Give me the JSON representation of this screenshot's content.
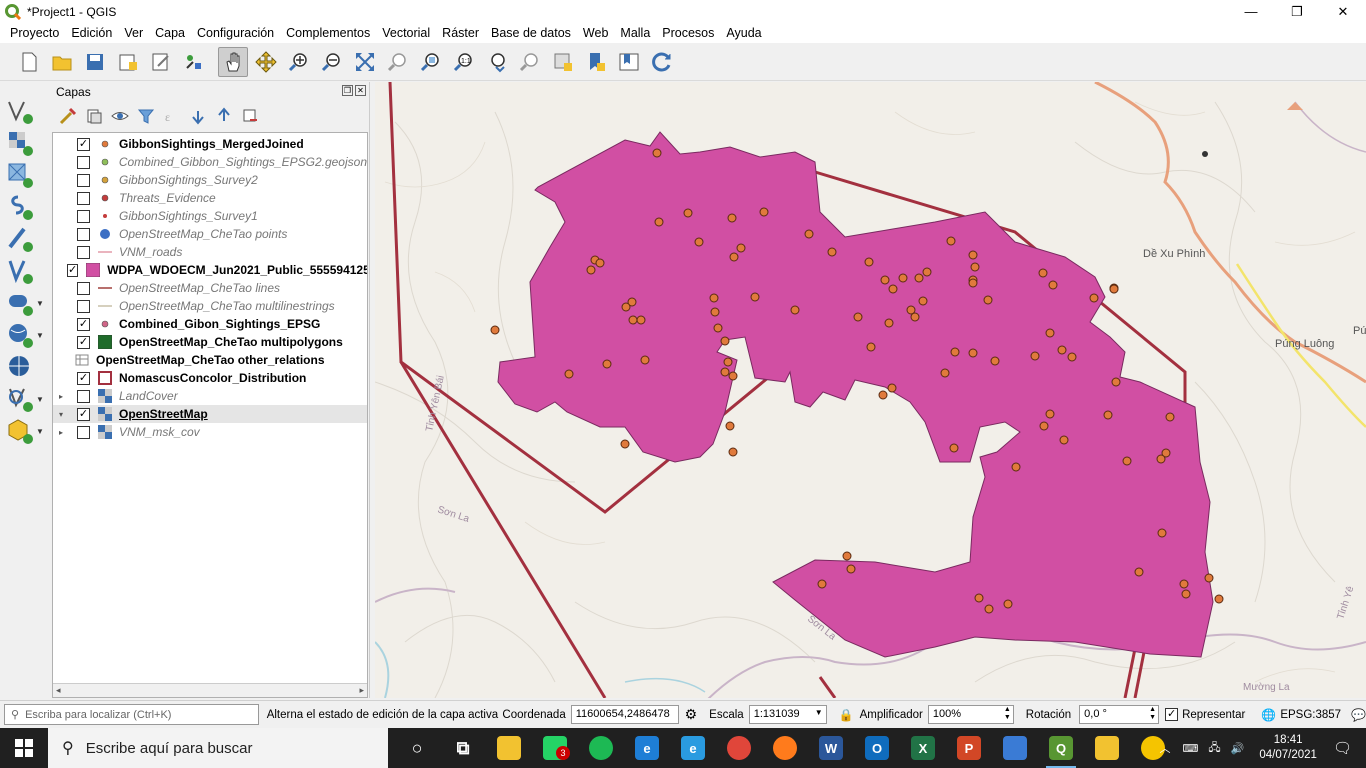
{
  "window": {
    "title": "*Project1 - QGIS",
    "controls": [
      "—",
      "❐",
      "✕"
    ]
  },
  "menu": [
    "Proyecto",
    "Edición",
    "Ver",
    "Capa",
    "Configuración",
    "Complementos",
    "Vectorial",
    "Ráster",
    "Base de datos",
    "Web",
    "Malla",
    "Procesos",
    "Ayuda"
  ],
  "toolbar_icons": [
    "new-project-icon",
    "open-project-icon",
    "save-project-icon",
    "new-print-layout-icon",
    "style-manager-icon",
    "pan-map-icon",
    "pan-to-selection-icon",
    "zoom-in-icon",
    "zoom-out-icon",
    "zoom-full-icon",
    "zoom-to-selection-icon",
    "zoom-to-layer-icon",
    "zoom-native-resolution-icon",
    "zoom-last-icon",
    "zoom-next-icon",
    "new-map-view-icon",
    "new-bookmark-icon",
    "show-bookmarks-icon",
    "refresh-icon"
  ],
  "layers_panel": {
    "title": "Capas",
    "layers": [
      {
        "name": "GibbonSightings_MergedJoined",
        "checked": true,
        "style": "bold",
        "symbol": "dot",
        "color": "#e07a3c",
        "expander": ""
      },
      {
        "name": "Combined_Gibbon_Sightings_EPSG2.geojson",
        "checked": false,
        "style": "italic",
        "symbol": "dot",
        "color": "#8fbf5a",
        "expander": ""
      },
      {
        "name": "GibbonSightings_Survey2",
        "checked": false,
        "style": "italic",
        "symbol": "dot",
        "color": "#d4a23c",
        "expander": ""
      },
      {
        "name": "Threats_Evidence",
        "checked": false,
        "style": "italic",
        "symbol": "dot",
        "color": "#c43c3c",
        "expander": ""
      },
      {
        "name": "GibbonSightings_Survey1",
        "checked": false,
        "style": "italic",
        "symbol": "smalldot",
        "color": "#c43c3c",
        "expander": ""
      },
      {
        "name": "OpenStreetMap_CheTao points",
        "checked": false,
        "style": "italic",
        "symbol": "bigdot",
        "color": "#3c6fc4",
        "expander": ""
      },
      {
        "name": "VNM_roads",
        "checked": false,
        "style": "italic",
        "symbol": "line",
        "color": "#e39aa8",
        "expander": ""
      },
      {
        "name": "WDPA_WDOECM_Jun2021_Public_555594125",
        "checked": true,
        "style": "bold",
        "symbol": "fill",
        "color": "#d14fa3",
        "expander": ""
      },
      {
        "name": "OpenStreetMap_CheTao lines",
        "checked": false,
        "style": "italic",
        "symbol": "line",
        "color": "#a0413c",
        "expander": ""
      },
      {
        "name": "OpenStreetMap_CheTao multilinestrings",
        "checked": false,
        "style": "italic",
        "symbol": "line",
        "color": "#c8c0a8",
        "expander": ""
      },
      {
        "name": "Combined_Gibon_Sightings_EPSG",
        "checked": true,
        "style": "bold",
        "symbol": "dot",
        "color": "#d06688",
        "expander": ""
      },
      {
        "name": "OpenStreetMap_CheTao multipolygons",
        "checked": true,
        "style": "bold",
        "symbol": "fill",
        "color": "#1f6b2a",
        "expander": ""
      },
      {
        "name": "OpenStreetMap_CheTao other_relations",
        "checked": null,
        "style": "bold",
        "symbol": "table",
        "color": "#888888",
        "expander": ""
      },
      {
        "name": "NomascusConcolor_Distribution",
        "checked": true,
        "style": "bold",
        "symbol": "outline",
        "color": "#a3303f",
        "expander": ""
      },
      {
        "name": "LandCover",
        "checked": false,
        "style": "italic",
        "symbol": "raster",
        "color": "#555555",
        "expander": "▸"
      },
      {
        "name": "OpenStreetMap",
        "checked": true,
        "style": "underline",
        "symbol": "raster",
        "color": "#555555",
        "expander": "▾"
      },
      {
        "name": "VNM_msk_cov",
        "checked": false,
        "style": "italic",
        "symbol": "raster",
        "color": "#555555",
        "expander": "▸"
      }
    ]
  },
  "map": {
    "colors": {
      "background": "#f2efe9",
      "protected_area_fill": "#d14fa3",
      "distribution_outline": "#a3303f",
      "sighting_points": "#e07a3c",
      "road": "#e8a07c"
    },
    "labels": [
      {
        "text": "Dề Xu Phình"
      },
      {
        "text": "Púng Luông"
      },
      {
        "text": "Tỉnh Yên Bái"
      },
      {
        "text": "Sơn La"
      },
      {
        "text": "Sơn La"
      },
      {
        "text": "Mường La"
      },
      {
        "text": "Tỉnh Yê"
      },
      {
        "text": "Pú"
      }
    ]
  },
  "status": {
    "locator_placeholder": "Escriba para localizar (Ctrl+K)",
    "message": "Alterna el estado de edición de la capa activa",
    "coordinate_label": "Coordenada",
    "coordinate_value": "11600654,2486478",
    "scale_label": "Escala",
    "scale_value": "1:131039",
    "magnifier_label": "Amplificador",
    "magnifier_value": "100%",
    "rotation_label": "Rotación",
    "rotation_value": "0,0 °",
    "render_label": "Representar",
    "render_checked": true,
    "crs": "EPSG:3857"
  },
  "taskbar": {
    "search_placeholder": "Escribe aquí para buscar",
    "apps": [
      {
        "name": "cortana-icon",
        "glyph": "○",
        "bg": "#202020"
      },
      {
        "name": "task-view-icon",
        "glyph": "⧉",
        "bg": "#202020"
      },
      {
        "name": "file-explorer-icon",
        "glyph": "",
        "bg": "#f2c230"
      },
      {
        "name": "whatsapp-icon",
        "glyph": "",
        "bg": "#25d366",
        "badge": "3"
      },
      {
        "name": "spotify-icon",
        "glyph": "",
        "bg": "#1db954"
      },
      {
        "name": "internet-explorer-icon",
        "glyph": "e",
        "bg": "#1e7ed6"
      },
      {
        "name": "edge-icon",
        "glyph": "e",
        "bg": "#2a9be0"
      },
      {
        "name": "chrome-icon",
        "glyph": "",
        "bg": "#e0463a"
      },
      {
        "name": "firefox-icon",
        "glyph": "",
        "bg": "#ff7b1c"
      },
      {
        "name": "word-icon",
        "glyph": "W",
        "bg": "#2b579a"
      },
      {
        "name": "outlook-icon",
        "glyph": "O",
        "bg": "#0f6cbd"
      },
      {
        "name": "excel-icon",
        "glyph": "X",
        "bg": "#217346"
      },
      {
        "name": "powerpoint-icon",
        "glyph": "P",
        "bg": "#d24726"
      },
      {
        "name": "magnifier-app-icon",
        "glyph": "",
        "bg": "#3a7bd5"
      },
      {
        "name": "qgis-icon",
        "glyph": "Q",
        "bg": "#589632",
        "active": true
      },
      {
        "name": "app-yellow-icon",
        "glyph": "",
        "bg": "#f2c230"
      },
      {
        "name": "sun-icon",
        "glyph": "",
        "bg": "#f5c400"
      }
    ],
    "tray_icons": [
      "chevron-up-icon",
      "input-icon",
      "network-icon",
      "volume-icon"
    ],
    "time": "18:41",
    "date": "04/07/2021"
  }
}
